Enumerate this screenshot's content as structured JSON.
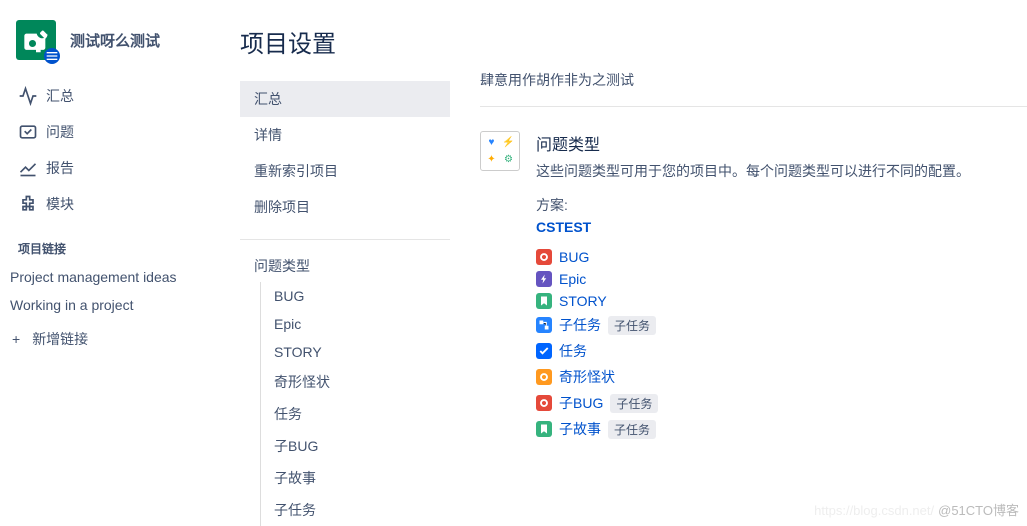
{
  "project": {
    "title": "测试呀么测试"
  },
  "leftNav": {
    "items": [
      {
        "label": "汇总"
      },
      {
        "label": "问题"
      },
      {
        "label": "报告"
      },
      {
        "label": "模块"
      }
    ],
    "linksHeading": "项目链接",
    "links": [
      {
        "label": "Project management ideas"
      },
      {
        "label": "Working in a project"
      }
    ],
    "addLink": "新增链接"
  },
  "settings": {
    "pageTitle": "项目设置",
    "general": [
      {
        "label": "汇总",
        "selected": true
      },
      {
        "label": "详情"
      },
      {
        "label": "重新索引项目"
      },
      {
        "label": "删除项目"
      }
    ],
    "issueTypesHeading": "问题类型",
    "issueTypes": [
      {
        "label": "BUG"
      },
      {
        "label": "Epic"
      },
      {
        "label": "STORY"
      },
      {
        "label": "奇形怪状"
      },
      {
        "label": "任务"
      },
      {
        "label": "子BUG"
      },
      {
        "label": "子故事"
      },
      {
        "label": "子任务"
      }
    ]
  },
  "summary": {
    "description": "肆意用作胡作非为之测试",
    "issueTypeTitle": "问题类型",
    "issueTypeDesc": "这些问题类型可用于您的项目中。每个问题类型可以进行不同的配置。",
    "schemeLabel": "方案:",
    "schemeName": "CSTEST",
    "types": [
      {
        "name": "BUG",
        "color": "c-red",
        "icon": "ring",
        "tag": null
      },
      {
        "name": "Epic",
        "color": "c-purple",
        "icon": "bolt",
        "tag": null
      },
      {
        "name": "STORY",
        "color": "c-green",
        "icon": "bookmark",
        "tag": null
      },
      {
        "name": "子任务",
        "color": "c-blue",
        "icon": "branch",
        "tag": "子任务"
      },
      {
        "name": "任务",
        "color": "c-check",
        "icon": "check",
        "tag": null
      },
      {
        "name": "奇形怪状",
        "color": "c-orange",
        "icon": "ring",
        "tag": null
      },
      {
        "name": "子BUG",
        "color": "c-red",
        "icon": "ring",
        "tag": "子任务"
      },
      {
        "name": "子故事",
        "color": "c-green",
        "icon": "bookmark",
        "tag": "子任务"
      }
    ]
  },
  "watermark": {
    "faint": "https://blog.csdn.net/",
    "text": "@51CTO博客"
  }
}
